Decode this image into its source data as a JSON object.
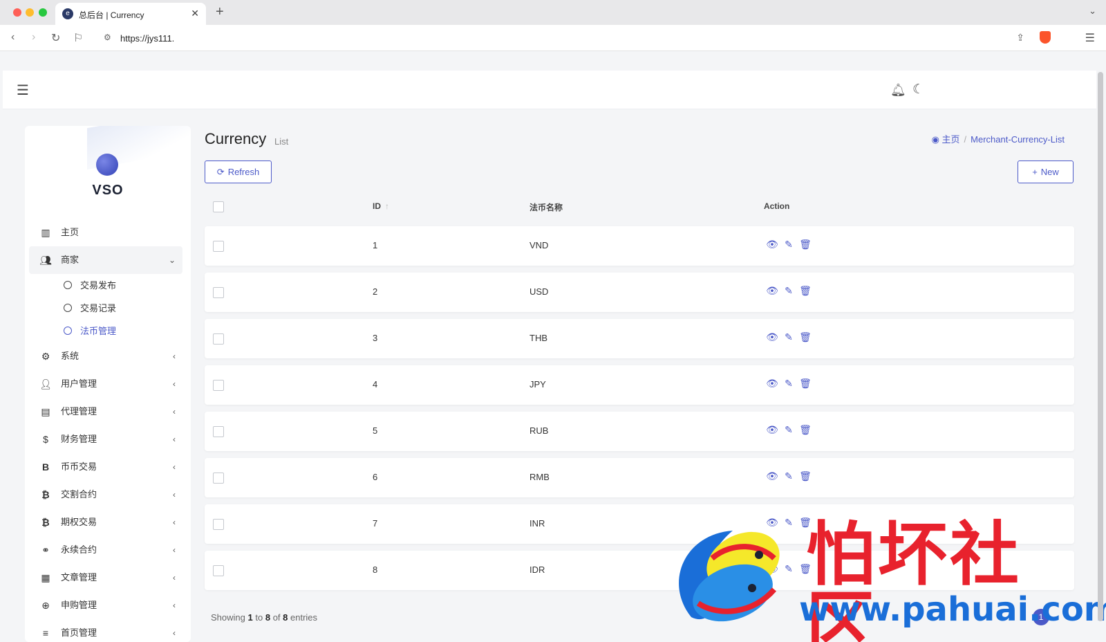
{
  "browser": {
    "tab_title": "总后台 | Currency",
    "url": "https://jys111."
  },
  "brand": {
    "name": "VSO"
  },
  "sidebar": {
    "items": [
      {
        "label": "主页",
        "icon": "bar-chart-icon"
      },
      {
        "label": "商家",
        "icon": "user-group-icon",
        "open": true,
        "children": [
          {
            "label": "交易发布"
          },
          {
            "label": "交易记录"
          },
          {
            "label": "法币管理",
            "active": true
          }
        ]
      },
      {
        "label": "系统",
        "icon": "gear-icon"
      },
      {
        "label": "用户管理",
        "icon": "user-icon"
      },
      {
        "label": "代理管理",
        "icon": "id-card-icon"
      },
      {
        "label": "财务管理",
        "icon": "dollar-icon"
      },
      {
        "label": "币币交易",
        "icon": "bold-b-icon"
      },
      {
        "label": "交割合约",
        "icon": "bitcoin-icon"
      },
      {
        "label": "期权交易",
        "icon": "bitcoin-icon"
      },
      {
        "label": "永续合约",
        "icon": "link-icon"
      },
      {
        "label": "文章管理",
        "icon": "newspaper-icon"
      },
      {
        "label": "申购管理",
        "icon": "lifebuoy-icon"
      },
      {
        "label": "首页管理",
        "icon": "list-icon"
      }
    ]
  },
  "page": {
    "title": "Currency",
    "subtitle": "List",
    "breadcrumb_home": "主页",
    "breadcrumb_current": "Merchant-Currency-List",
    "refresh_label": "Refresh",
    "new_label": "New"
  },
  "table": {
    "columns": [
      "ID",
      "法币名称",
      "Action"
    ],
    "rows": [
      {
        "id": "1",
        "name": "VND"
      },
      {
        "id": "2",
        "name": "USD"
      },
      {
        "id": "3",
        "name": "THB"
      },
      {
        "id": "4",
        "name": "JPY"
      },
      {
        "id": "5",
        "name": "RUB"
      },
      {
        "id": "6",
        "name": "RMB"
      },
      {
        "id": "7",
        "name": "INR"
      },
      {
        "id": "8",
        "name": "IDR"
      }
    ]
  },
  "footer": {
    "showing": "Showing",
    "from": "1",
    "to_word": "to",
    "to": "8",
    "of_word": "of",
    "total": "8",
    "entries": "entries",
    "current_page": "1"
  },
  "watermark": {
    "cn_text": "怕坏社区",
    "url_text": "www.pahuai.com"
  },
  "colors": {
    "accent": "#4b59c8",
    "watermark_red": "#e8222d",
    "watermark_blue": "#1a6ed8"
  }
}
